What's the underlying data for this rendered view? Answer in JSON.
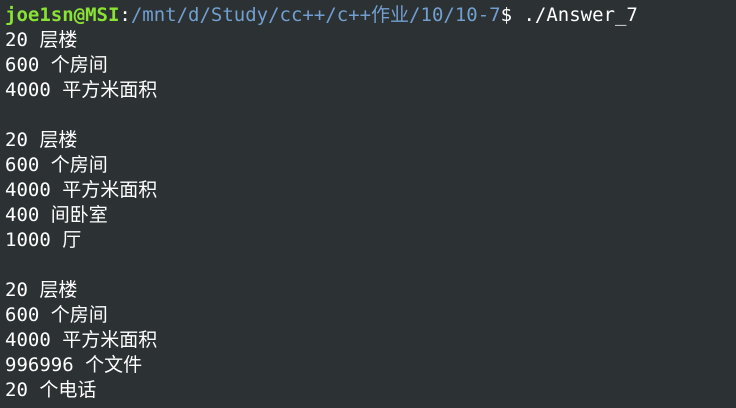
{
  "prompt": {
    "user_host": "joe1sn@MSI",
    "colon": ":",
    "path": "/mnt/d/Study/cc++/c++作业/10/10-7",
    "dollar": "$",
    "command": " ./Answer_7"
  },
  "output": {
    "block1": [
      "20 层楼",
      "600 个房间",
      "4000 平方米面积"
    ],
    "block2": [
      "20 层楼",
      "600 个房间",
      "4000 平方米面积",
      "400 间卧室",
      "1000 厅"
    ],
    "block3": [
      "20 层楼",
      "600 个房间",
      "4000 平方米面积",
      "996996 个文件",
      "20 个电话"
    ]
  },
  "colors": {
    "background": "#2c3134",
    "user_host": "#8ae234",
    "path": "#729fcf",
    "text": "#ffffff"
  }
}
